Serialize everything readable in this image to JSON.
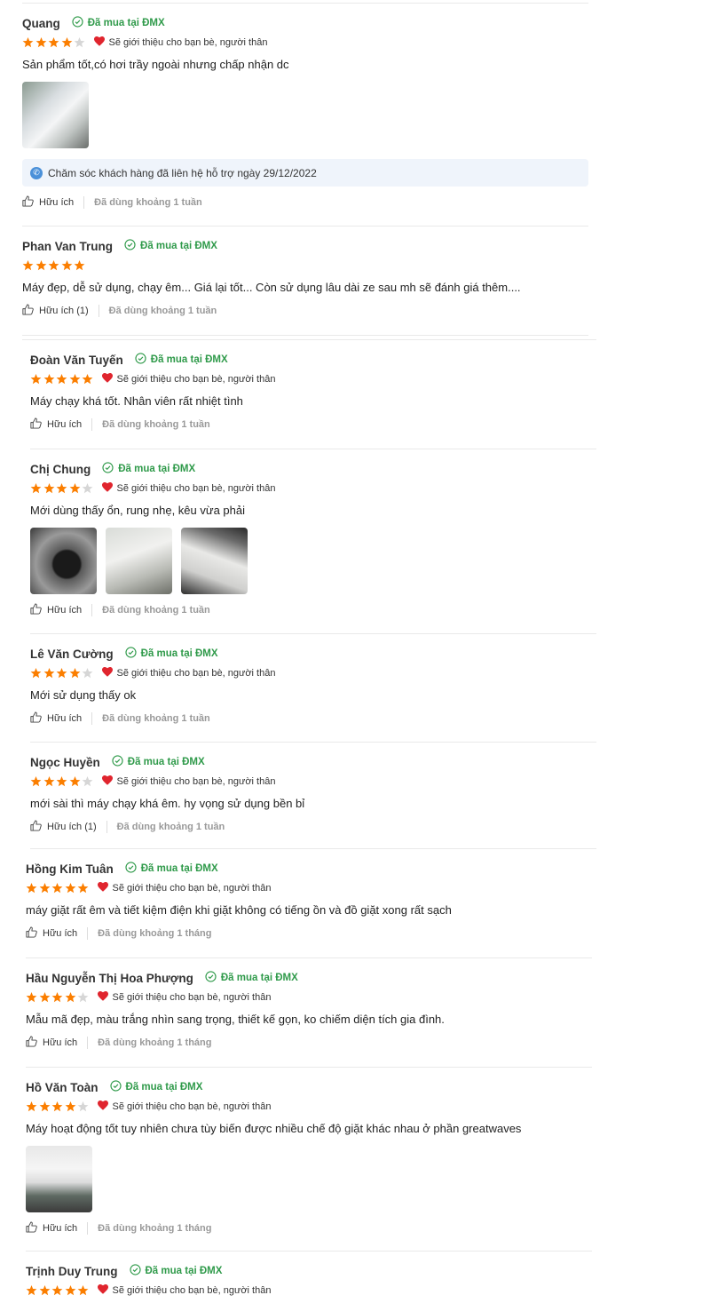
{
  "verified_label": "Đã mua tại ĐMX",
  "recommend_label": "Sẽ giới thiệu cho bạn bè, người thân",
  "colors": {
    "star": "#fb7e00",
    "star_empty": "#d6d6d6",
    "verified": "#2f9a4a",
    "heart": "#e0252e"
  },
  "reviews": [
    {
      "name": "Quang",
      "stars": 4,
      "recommend": true,
      "content": "Sản phẩm tốt,có hơi trầy ngoài nhưng chấp nhận dc",
      "photos": 1,
      "support": "Chăm sóc khách hàng đã liên hệ hỗ trợ ngày 29/12/2022",
      "helpful": "Hữu ích",
      "used": "Đã dùng khoảng 1 tuần"
    },
    {
      "name": "Phan Van Trung",
      "stars": 5,
      "recommend": false,
      "content": "Máy đẹp, dễ sử dụng, chạy êm... Giá lại tốt... Còn sử dụng lâu dài ze sau mh sẽ đánh giá thêm....",
      "photos": 0,
      "helpful": "Hữu ích (1)",
      "used": "Đã dùng khoảng 1 tuần"
    },
    {
      "name": "Đoàn Văn Tuyến",
      "stars": 5,
      "recommend": true,
      "content": "Máy chạy khá tốt. Nhân viên rất nhiệt tình",
      "photos": 0,
      "helpful": "Hữu ích",
      "used": "Đã dùng khoảng 1 tuần"
    },
    {
      "name": "Chị Chung",
      "stars": 4,
      "recommend": true,
      "content": "Mới dùng thấy ổn, rung nhẹ, kêu vừa phải",
      "photos": 3,
      "helpful": "Hữu ích",
      "used": "Đã dùng khoảng 1 tuần"
    },
    {
      "name": "Lê Văn Cường",
      "stars": 4,
      "recommend": true,
      "content": "Mới sử dụng thấy ok",
      "photos": 0,
      "helpful": "Hữu ích",
      "used": "Đã dùng khoảng 1 tuần"
    },
    {
      "name": "Ngọc Huyền",
      "stars": 4,
      "recommend": true,
      "content": "mới sài thì máy chạy khá êm. hy vọng sử dụng bền bỉ",
      "photos": 0,
      "helpful": "Hữu ích (1)",
      "used": "Đã dùng khoảng 1 tuần"
    },
    {
      "name": "Hồng Kim Tuân",
      "stars": 5,
      "recommend": true,
      "content": "máy giặt rất êm và tiết kiệm điện khi giặt không có tiếng ồn và đồ giặt xong rất sạch",
      "photos": 0,
      "helpful": "Hữu ích",
      "used": "Đã dùng khoảng 1 tháng"
    },
    {
      "name": "Hầu Nguyễn Thị Hoa Phượng",
      "stars": 4,
      "recommend": true,
      "content": "Mẫu mã đẹp, màu trắng nhìn sang trọng, thiết kế gọn, ko chiếm diện tích gia đình.",
      "photos": 0,
      "helpful": "Hữu ích",
      "used": "Đã dùng khoảng 1 tháng"
    },
    {
      "name": "Hồ Văn Toàn",
      "stars": 4,
      "recommend": true,
      "content": "Máy hoạt động tốt tuy nhiên chưa tùy biến được nhiều chế độ giặt khác nhau ở phần greatwaves",
      "photos": 1,
      "helpful": "Hữu ích",
      "used": "Đã dùng khoảng 1 tháng"
    },
    {
      "name": "Trịnh Duy Trung",
      "stars": 5,
      "recommend": true,
      "content": "",
      "photos": 0,
      "helpful": "",
      "used": ""
    }
  ]
}
